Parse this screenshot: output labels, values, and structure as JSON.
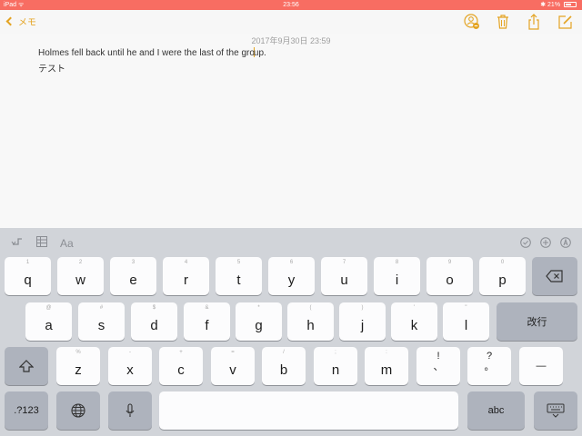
{
  "status": {
    "left": "iPad ᯤ",
    "time": "23:56",
    "right": "✱ 21%"
  },
  "nav": {
    "back_label": "メモ"
  },
  "note": {
    "date": "2017年9月30日 23:59",
    "line1_before_caret": "Holmes fell back until he and I were the last of the gro",
    "line1_after_caret": "up.",
    "line2": "テスト"
  },
  "keyboard": {
    "toolbar": {
      "format_label": "Aa"
    },
    "row1": [
      {
        "hint": "1",
        "label": "q"
      },
      {
        "hint": "2",
        "label": "w"
      },
      {
        "hint": "3",
        "label": "e"
      },
      {
        "hint": "4",
        "label": "r"
      },
      {
        "hint": "5",
        "label": "t"
      },
      {
        "hint": "6",
        "label": "y"
      },
      {
        "hint": "7",
        "label": "u"
      },
      {
        "hint": "8",
        "label": "i"
      },
      {
        "hint": "9",
        "label": "o"
      },
      {
        "hint": "0",
        "label": "p"
      }
    ],
    "row2": [
      {
        "hint": "@",
        "label": "a"
      },
      {
        "hint": "#",
        "label": "s"
      },
      {
        "hint": "$",
        "label": "d"
      },
      {
        "hint": "&",
        "label": "f"
      },
      {
        "hint": "*",
        "label": "g"
      },
      {
        "hint": "(",
        "label": "h"
      },
      {
        "hint": ")",
        "label": "j"
      },
      {
        "hint": "'",
        "label": "k"
      },
      {
        "hint": "\"",
        "label": "l"
      }
    ],
    "return_label": "改行",
    "row3": [
      {
        "hint": "%",
        "label": "z"
      },
      {
        "hint": "-",
        "label": "x"
      },
      {
        "hint": "+",
        "label": "c"
      },
      {
        "hint": "=",
        "label": "v"
      },
      {
        "hint": "/",
        "label": "b"
      },
      {
        "hint": ";",
        "label": "n"
      },
      {
        "hint": ":",
        "label": "m"
      }
    ],
    "punct1": {
      "top": "!",
      "bottom": "、"
    },
    "punct2": {
      "top": "?",
      "bottom": "。"
    },
    "dash_label": "—",
    "numbers_label": ".?123",
    "abc_label": "abc",
    "colors": {
      "accent": "#e4a423",
      "status_bar": "#f86d62",
      "keyboard_bg": "#d1d4d9"
    }
  }
}
